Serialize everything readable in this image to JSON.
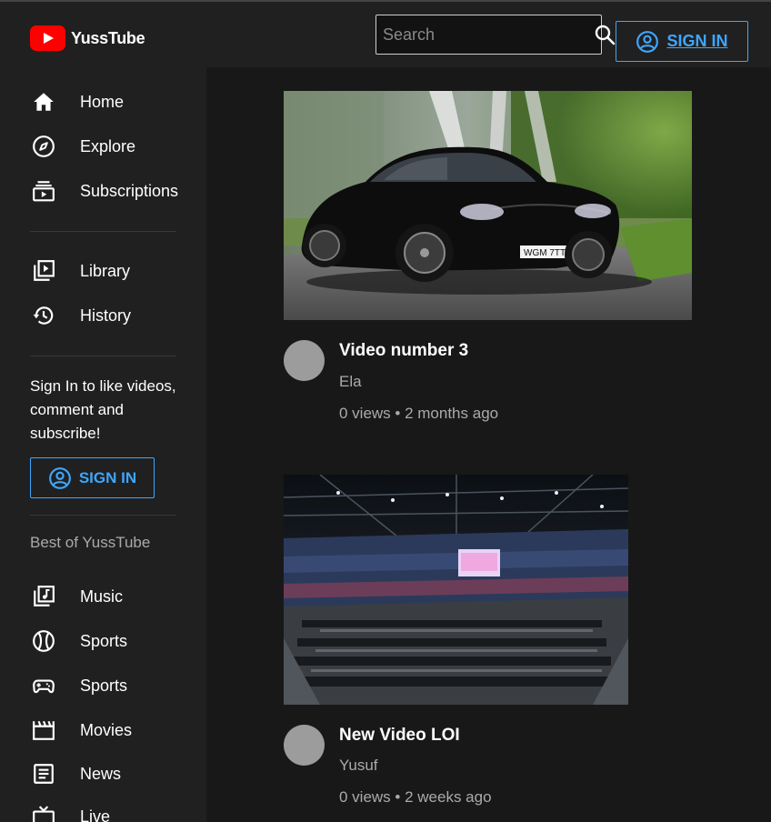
{
  "app": {
    "name": "YussTube",
    "accent": "#3ea6ff",
    "brand": "#ff0000"
  },
  "header": {
    "search": {
      "placeholder": "Search",
      "value": "",
      "icon": "search-icon"
    },
    "sign_in_label": "SIGN IN"
  },
  "sidebar": {
    "primary": [
      {
        "label": "Home",
        "icon": "home-icon"
      },
      {
        "label": "Explore",
        "icon": "compass-icon"
      },
      {
        "label": "Subscriptions",
        "icon": "subscriptions-icon"
      }
    ],
    "secondary": [
      {
        "label": "Library",
        "icon": "library-icon"
      },
      {
        "label": "History",
        "icon": "history-icon"
      }
    ],
    "sign_in_prompt": "Sign In to like videos, comment and subscribe!",
    "sign_in_label": "SIGN IN",
    "best_of_title": "Best of YussTube",
    "best_of": [
      {
        "label": "Music",
        "icon": "music-icon"
      },
      {
        "label": "Sports",
        "icon": "sports-ball-icon"
      },
      {
        "label": "Sports",
        "icon": "gamepad-icon"
      },
      {
        "label": "Movies",
        "icon": "clapperboard-icon"
      },
      {
        "label": "News",
        "icon": "news-icon"
      },
      {
        "label": "Live",
        "icon": "live-tv-icon"
      }
    ]
  },
  "videos": [
    {
      "title": "Video number 3",
      "channel": "Ela",
      "meta": "0 views • 2 months ago",
      "thumbnail": "black sports car on road"
    },
    {
      "title": "New Video LOI",
      "channel": "Yusuf",
      "meta": "0 views • 2 weeks ago",
      "thumbnail": "esports arena interior"
    }
  ]
}
